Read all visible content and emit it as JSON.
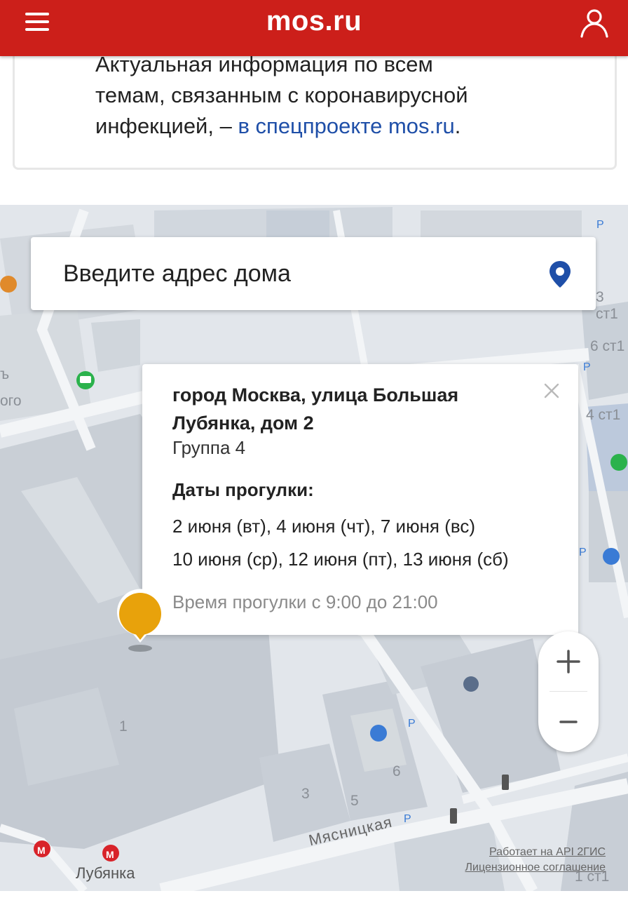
{
  "header": {
    "logo": "mos.ru",
    "menu_icon": "hamburger-menu-icon",
    "user_icon": "user-profile-icon",
    "brand_color": "#cc1f1a"
  },
  "info_card": {
    "text_lines": [
      "Актуальная информация по всем",
      "темам, связанным с коронавирусной",
      "инфекцией, – "
    ],
    "link_text": "в спецпроекте mos.ru",
    "trailing": "."
  },
  "map": {
    "search": {
      "placeholder": "Введите адрес дома",
      "pin_icon": "location-pin-icon",
      "pin_color": "#1f4fa8"
    },
    "popup": {
      "address": "город Москва, улица Большая Лубянка, дом 2",
      "group": "Группа 4",
      "dates_title": "Даты прогулки:",
      "dates_line1": "2 июня (вт), 4 июня (чт), 7 июня (вс)",
      "dates_line2": "10 июня (ср), 12 июня (пт), 13 июня (сб)",
      "time": "Время прогулки с 9:00 до 21:00",
      "close_icon": "close-icon"
    },
    "marker_color": "#e8a20b",
    "zoom": {
      "in": "+",
      "out": "−"
    },
    "labels": {
      "building_1": "1",
      "building_3": "3",
      "building_5": "5",
      "building_6": "6",
      "metro_station": "Лубянка",
      "street": "Мясницкая",
      "right_labels": [
        "3 ст1",
        "6 ст1",
        "4 ст1",
        "1 ст1"
      ],
      "left_labels": [
        "ъ",
        "ого"
      ]
    },
    "credits": {
      "api": "Работает на API 2ГИС",
      "license": "Лицензионное соглашение"
    }
  }
}
